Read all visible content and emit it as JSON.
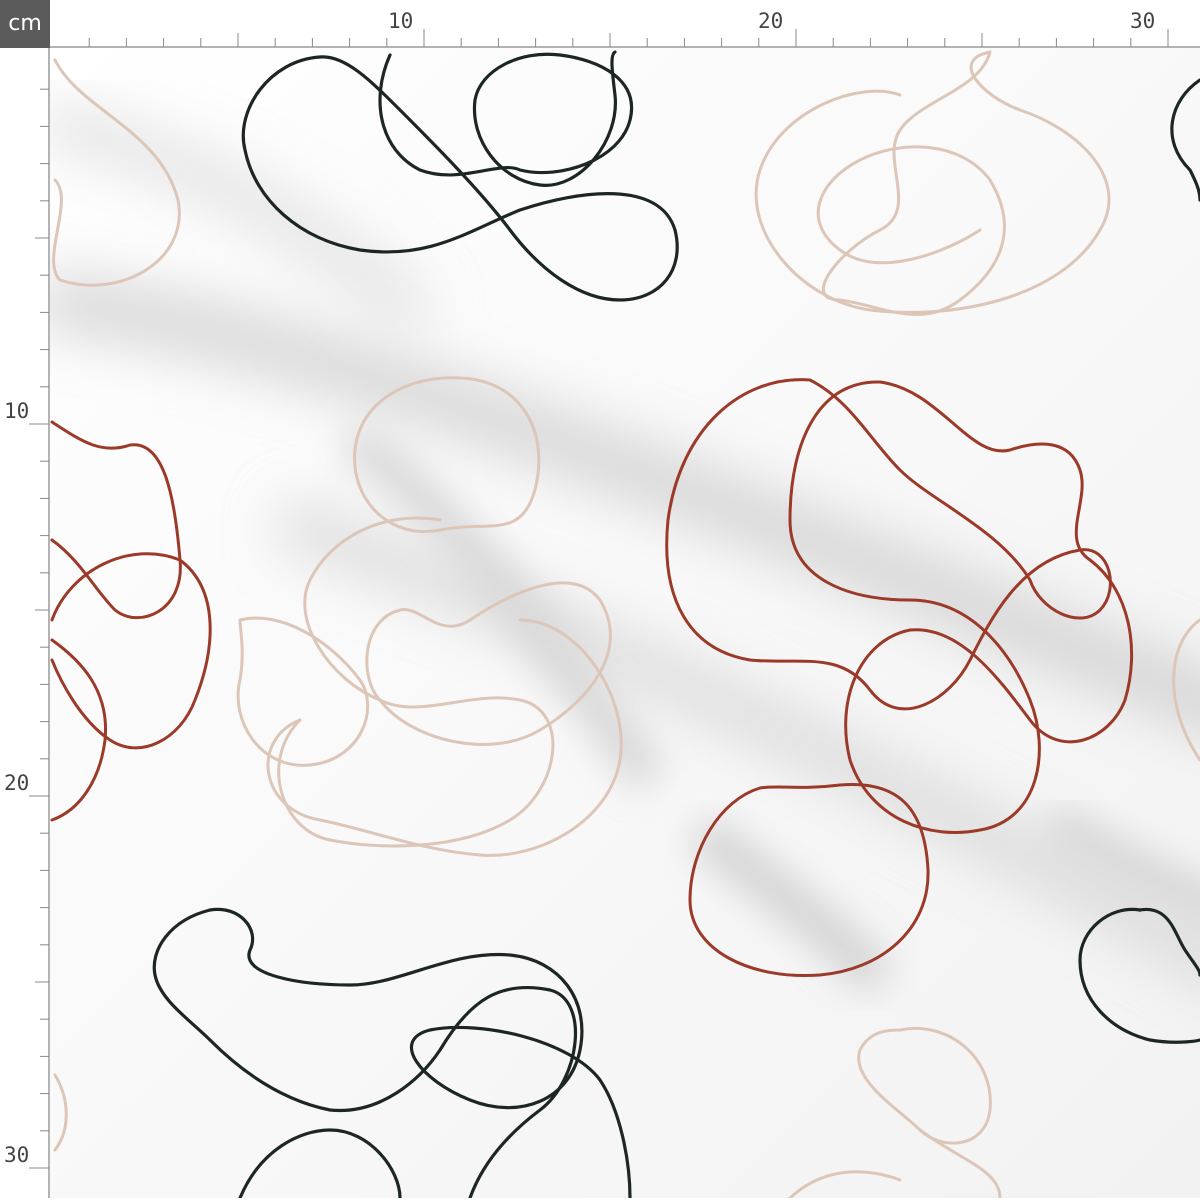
{
  "ruler": {
    "unit": "cm",
    "top_labels": [
      "10",
      "20",
      "30"
    ],
    "left_labels": [
      "10",
      "20",
      "30"
    ]
  },
  "fabric": {
    "background": "#f4f4f3",
    "pattern": "abstract line squiggles",
    "colors": {
      "black": "#1c2622",
      "rust": "#9c3a2a",
      "beige": "#dcc6b8"
    }
  }
}
